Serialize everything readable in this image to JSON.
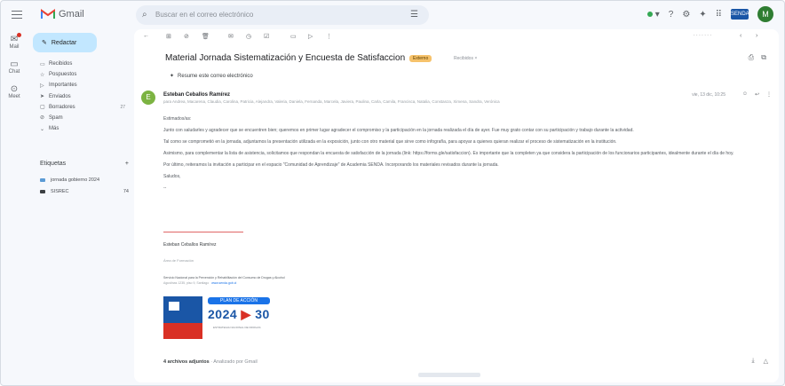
{
  "app": {
    "name": "Gmail"
  },
  "search": {
    "placeholder": "Buscar en el correo electrónico"
  },
  "topbar": {
    "org_logo_text": "SENDA",
    "avatar_initial": "M"
  },
  "rail": [
    {
      "label": "Mail"
    },
    {
      "label": "Chat"
    },
    {
      "label": "Meet"
    }
  ],
  "compose": {
    "label": "Redactar"
  },
  "nav": [
    {
      "icon": "▭",
      "label": "Recibidos",
      "count": ""
    },
    {
      "icon": "☆",
      "label": "Pospuestos",
      "count": ""
    },
    {
      "icon": "▷",
      "label": "Importantes",
      "count": ""
    },
    {
      "icon": "➤",
      "label": "Enviados",
      "count": ""
    },
    {
      "icon": "▢",
      "label": "Borradores",
      "count": "27"
    },
    {
      "icon": "⊘",
      "label": "Spam",
      "count": ""
    },
    {
      "icon": "⌄",
      "label": "Más",
      "count": ""
    }
  ],
  "labels": {
    "title": "Etiquetas",
    "items": [
      {
        "label": "jornada gobierno 2024",
        "count": "",
        "color": "#5b9bd5"
      },
      {
        "label": "SISREC",
        "count": "74",
        "color": "#3c4043"
      }
    ]
  },
  "message": {
    "subject": "Material Jornada Sistematización y Encuesta de Satisfaccion",
    "badge": "Externo",
    "inbox_chip": "Recibidos",
    "summary": "Resume este correo electrónico",
    "sender_initial": "E",
    "sender": "Esteban Ceballos Ramírez",
    "date": "vie, 13 dic, 10:25",
    "recipients": "para Andrea, Macarena, Claudia, Carolina, Patricia, Alejandra, Valeria, Daniela, Fernanda, Marcela, Javiera, Paulina, Carla, Camila, Francisca, Natalia, Constanza, Ximena, Sandra, Verónica",
    "greeting": "Estimados/as:",
    "body": [
      "Junto con saludarles y agradecer que se encuentren bien; queremos en primer lugar agradecer el compromiso y la participación en la jornada realizada el día de ayer. Fue muy grato contar con su participación y trabajo durante la actividad.",
      "Tal como se comprometió en la jornada, adjuntamos la presentación utilizada en la exposición, junto con otro material que sirve como infografía, para apoyar a quienes quieran realizar el proceso de sistematización en la institución.",
      "Asimismo, para complementar la lista de asistencia, solicitamos que respondan la encuesta de satisfacción de la jornada (link: https://forms.gle/satisfaccion). Es importante que la completen ya que considera la participación de los funcionarios participantes, idealmente durante el día de hoy.",
      "Por último, reiteramos la invitación a participar en el espacio \"Comunidad de Aprendizaje\" de Academia SENDA. Incorporando los materiales revisados durante la jornada."
    ],
    "closing": "Saludos,",
    "sig_dash": "--",
    "signature": {
      "name": "Esteban Ceballos Ramírez",
      "role": "Área de Formación",
      "org": "Servicio Nacional para la Prevención y Rehabilitación del Consumo de Drogas y Alcohol",
      "address": "Agustinas 1235, piso 9, Santiago",
      "web": "www.senda.gob.cl"
    },
    "banner": {
      "pill": "PLAN DE ACCIÓN",
      "year_start": "2024",
      "arrow": "▶",
      "year_end": "30",
      "subtitle": "ESTRATEGIA NACIONAL DE DROGAS"
    },
    "attachments": {
      "count_label": "4 archivos adjuntos",
      "scan_label": "· Analizado por Gmail"
    }
  }
}
